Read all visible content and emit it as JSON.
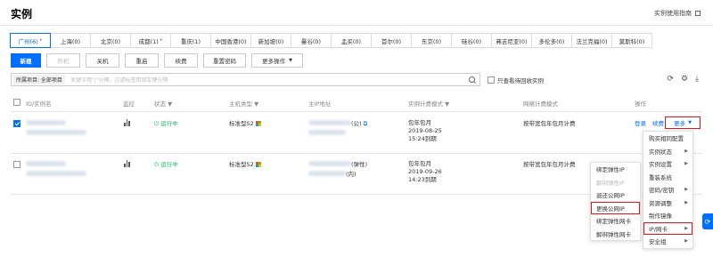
{
  "page": {
    "title": "实例",
    "guide_link": "实例使用指南"
  },
  "regions": [
    {
      "label": "广州(6)",
      "star": true,
      "active": true
    },
    {
      "label": "上海(0)"
    },
    {
      "label": "北京(0)"
    },
    {
      "label": "成都(1)",
      "star": true
    },
    {
      "label": "重庆(1)"
    },
    {
      "label": "中国香港(0)"
    },
    {
      "label": "新加坡(0)"
    },
    {
      "label": "曼谷(0)"
    },
    {
      "label": "孟买(0)"
    },
    {
      "label": "首尔(0)"
    },
    {
      "label": "东京(0)"
    },
    {
      "label": "硅谷(0)"
    },
    {
      "label": "弗吉尼亚(0)"
    },
    {
      "label": "多伦多(0)"
    },
    {
      "label": "法兰克福(0)"
    },
    {
      "label": "莫斯科(0)"
    }
  ],
  "toolbar": {
    "new": "新建",
    "start": "开机",
    "shutdown": "关机",
    "restart": "重启",
    "renew": "续费",
    "reset_password": "重置密码",
    "more_ops": "更多操作"
  },
  "filter": {
    "tag": "所属项目: 全部项目",
    "placeholder": "关键字用\"|\"分隔，过滤标签用回车键分隔"
  },
  "recycle_label": "只查看待回收实例",
  "table": {
    "headers": {
      "id": "ID/实例名",
      "monitor": "监控",
      "status": "状态",
      "type": "主机类型",
      "ip": "主IP地址",
      "billing": "实例计费模式",
      "network_billing": "网络计费模式",
      "actions": "操作"
    },
    "rows": [
      {
        "status": "运行中",
        "type": "标准型S2",
        "ip_suffix": "(公)",
        "billing_mode": "包年包月",
        "date": "2019-08-25",
        "expire": "15:24到期",
        "network": "按带宽包年包月计费",
        "login": "登录",
        "renew": "续费",
        "more": "更多",
        "checked": true
      },
      {
        "status": "运行中",
        "type": "标准型S2",
        "ip_suffix": "(弹性)",
        "ip_suffix2": "(内)",
        "billing_mode": "包年包月",
        "date": "2019-09-26",
        "expire": "14:23到期",
        "network": "按带宽包年包月计费",
        "checked": false
      }
    ]
  },
  "menu_main": [
    {
      "label": "购买相同配置"
    },
    {
      "label": "实例状态",
      "sub": true
    },
    {
      "label": "实例设置",
      "sub": true
    },
    {
      "label": "重装系统"
    },
    {
      "label": "密码/密钥",
      "sub": true
    },
    {
      "label": "资源调整",
      "sub": true
    },
    {
      "label": "制作镜像"
    },
    {
      "label": "IP/网卡",
      "sub": true,
      "highlight": true
    },
    {
      "label": "安全组",
      "sub": true
    }
  ],
  "menu_sub": [
    {
      "label": "绑定弹性IP"
    },
    {
      "label": "解绑弹性IP",
      "disabled": true
    },
    {
      "label": "退还公网IP"
    },
    {
      "label": "更换公网IP",
      "highlight": true
    },
    {
      "label": "绑定弹性网卡"
    },
    {
      "label": "解绑弹性网卡"
    }
  ],
  "colors": {
    "accent": "#006eff",
    "highlight": "#e1141e",
    "running": "#0abf5b"
  }
}
